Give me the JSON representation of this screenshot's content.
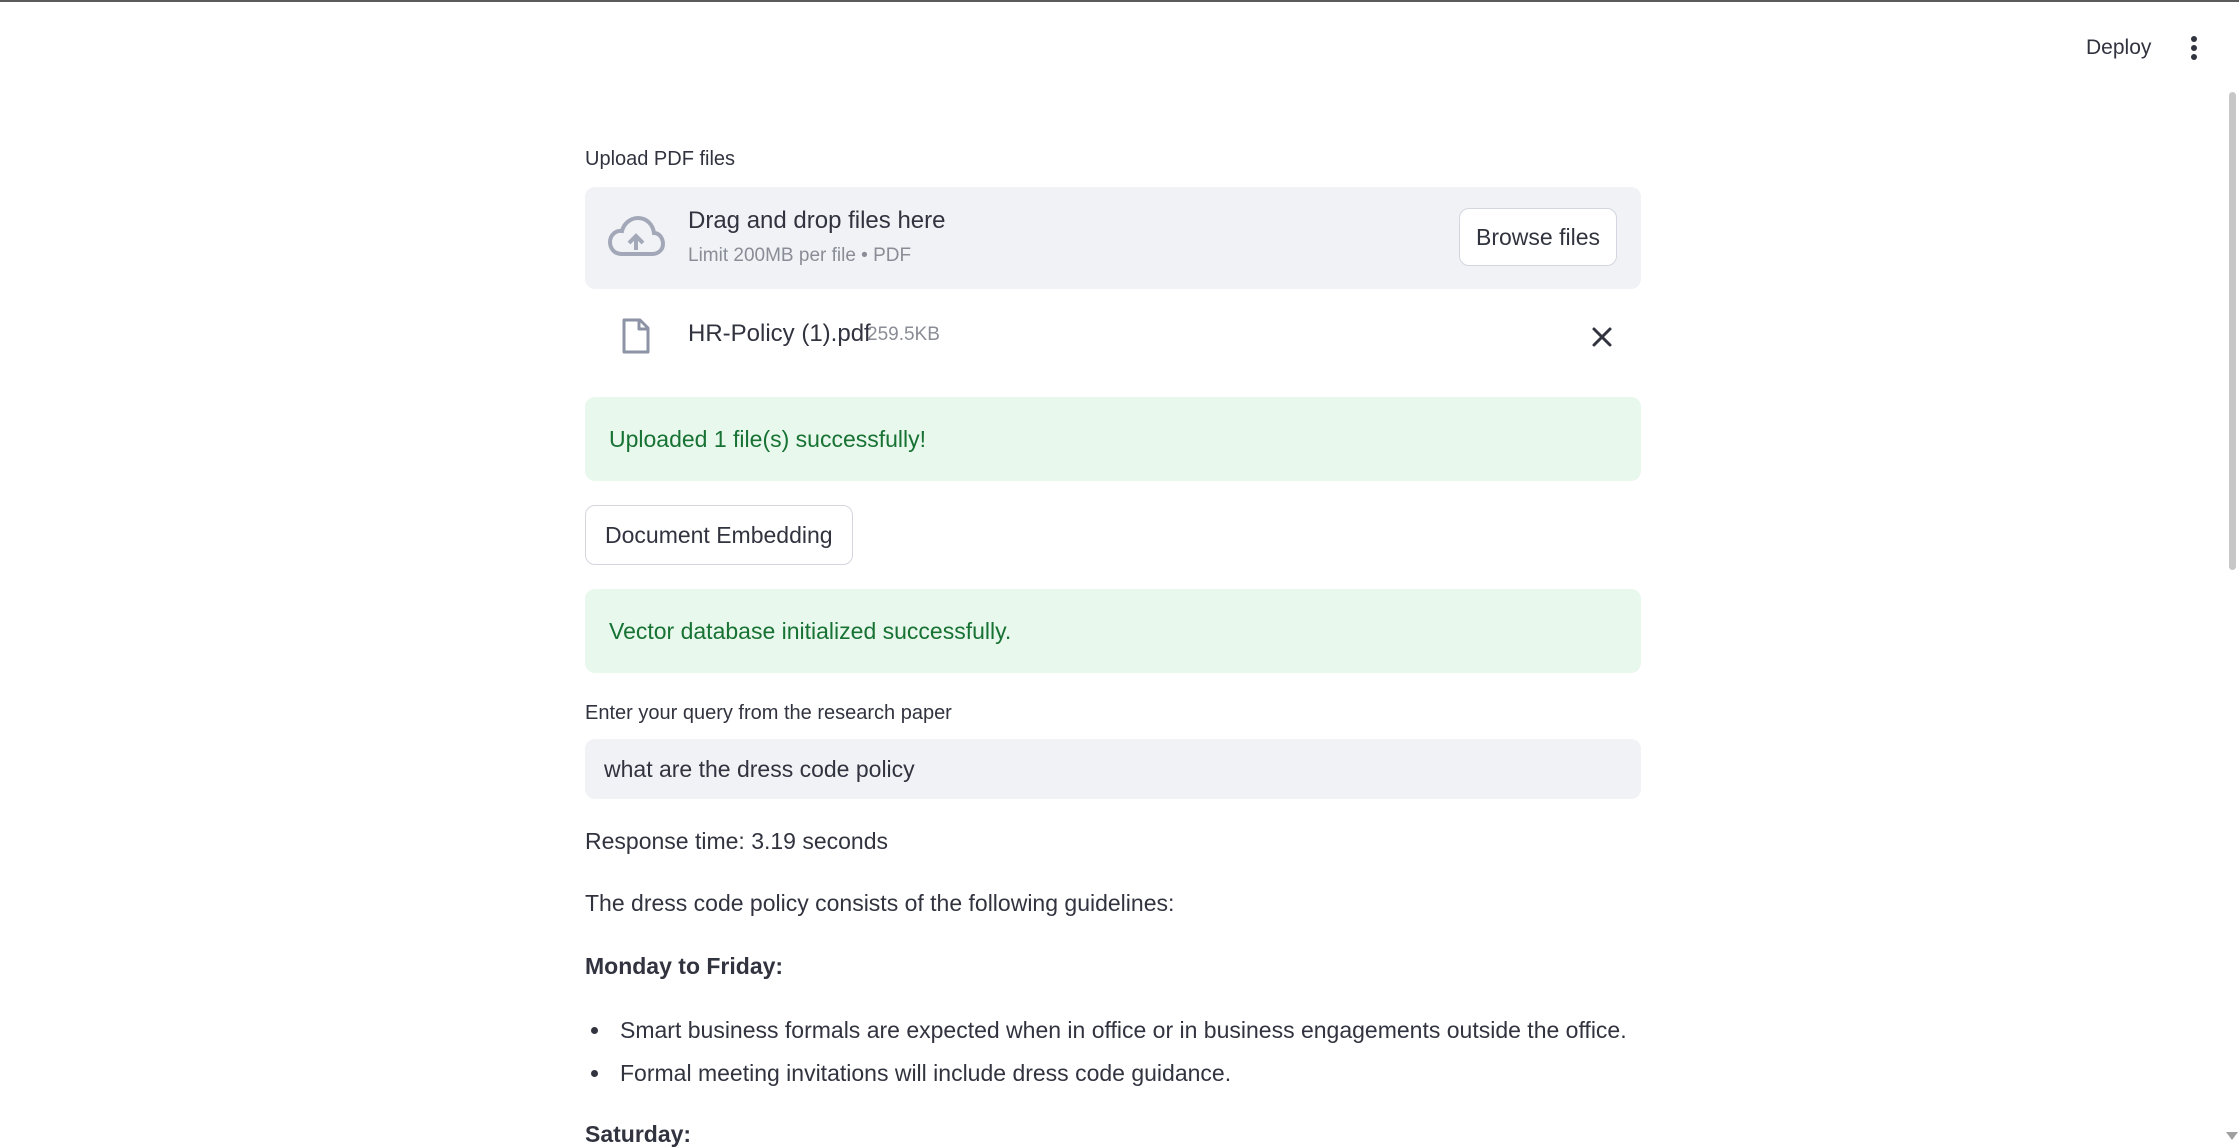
{
  "header": {
    "deploy_label": "Deploy",
    "menu_icon": "more-vertical-icon"
  },
  "uploader": {
    "label": "Upload PDF files",
    "drop_title": "Drag and drop files here",
    "drop_subtitle": "Limit 200MB per file • PDF",
    "browse_label": "Browse files",
    "upload_icon": "cloud-upload-icon"
  },
  "uploaded_file": {
    "name": "HR-Policy (1).pdf",
    "size": "259.5KB",
    "file_icon": "file-icon",
    "remove_icon": "close-icon"
  },
  "upload_status": {
    "message": "Uploaded 1 file(s) successfully!"
  },
  "embedding": {
    "button_label": "Document Embedding",
    "status_message": "Vector database initialized successfully."
  },
  "query": {
    "label": "Enter your query from the research paper",
    "value": "what are the dress code policy"
  },
  "response": {
    "time_text": "Response time: 3.19 seconds",
    "intro": "The dress code policy consists of the following guidelines:",
    "section1_heading": "Monday to Friday:",
    "section1_items": [
      "Smart business formals are expected when in office or in business engagements outside the office.",
      "Formal meeting invitations will include dress code guidance."
    ],
    "section2_heading": "Saturday:"
  },
  "colors": {
    "success_bg": "#e8f8ed",
    "success_text": "#177233",
    "input_bg": "#f0f2f6",
    "text": "#31333f"
  }
}
